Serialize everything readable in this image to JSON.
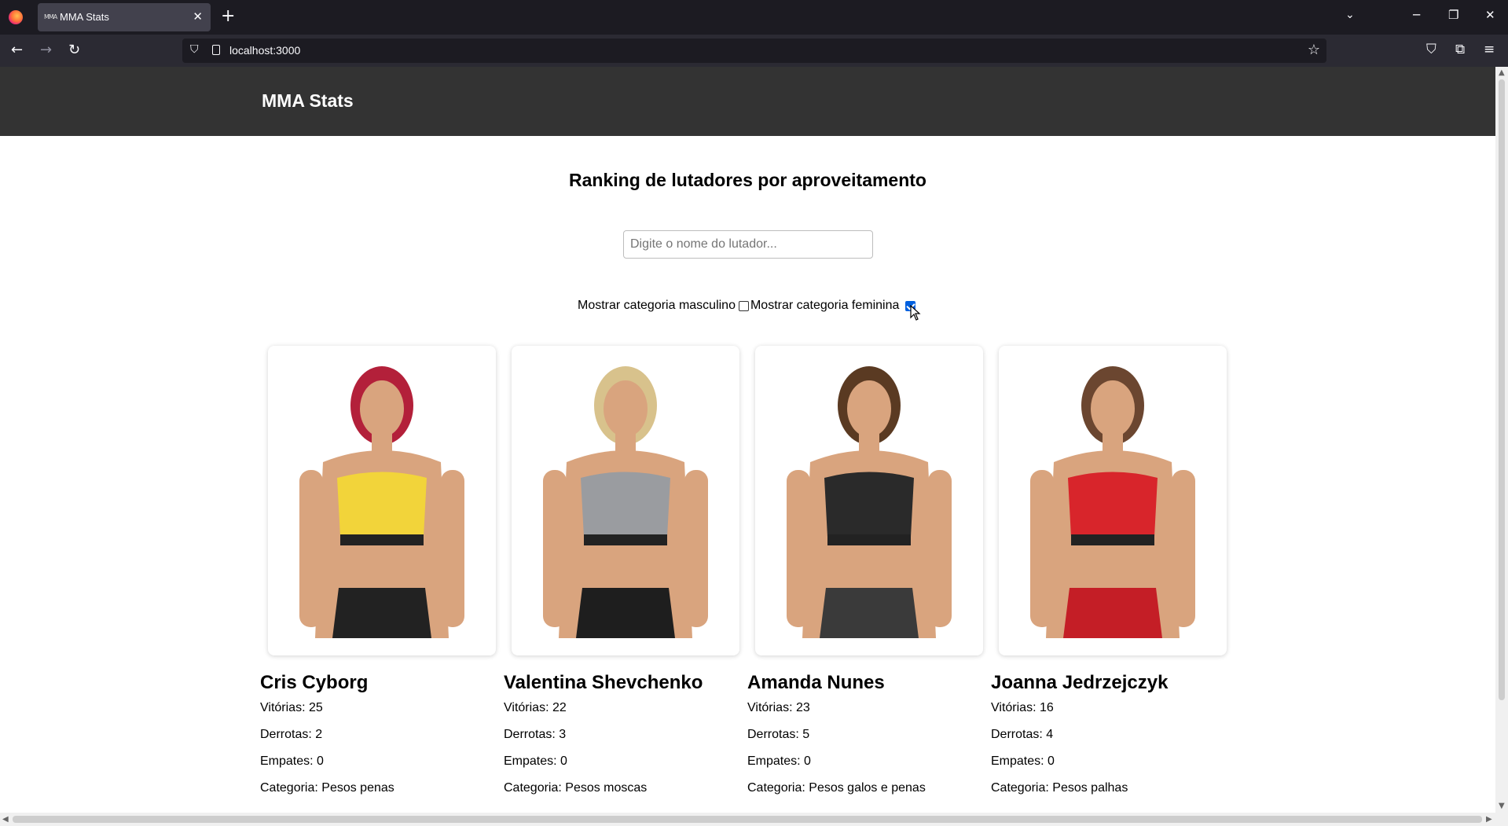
{
  "browser": {
    "tab_title": "MMA Stats",
    "tab_favicon": "MMA",
    "url": "localhost:3000"
  },
  "site": {
    "title": "MMA Stats",
    "heading": "Ranking de lutadores por aproveitamento",
    "search_placeholder": "Digite o nome do lutador...",
    "filter_male_label": "Mostrar categoria masculino",
    "filter_male_checked": false,
    "filter_female_label": "Mostrar categoria feminina",
    "filter_female_checked": true
  },
  "fighters": [
    {
      "name": "Cris Cyborg",
      "wins": "Vitórias: 25",
      "losses": "Derrotas: 2",
      "draws": "Empates: 0",
      "category": "Categoria: Pesos penas",
      "top_color": "#f2d43a",
      "bottom_color": "#222222",
      "hair_color": "#b3203a"
    },
    {
      "name": "Valentina Shevchenko",
      "wins": "Vitórias: 22",
      "losses": "Derrotas: 3",
      "draws": "Empates: 0",
      "category": "Categoria: Pesos moscas",
      "top_color": "#9a9ca0",
      "bottom_color": "#1e1e1e",
      "hair_color": "#d8c28c"
    },
    {
      "name": "Amanda Nunes",
      "wins": "Vitórias: 23",
      "losses": "Derrotas: 5",
      "draws": "Empates: 0",
      "category": "Categoria: Pesos galos e penas",
      "top_color": "#2a2a2a",
      "bottom_color": "#3a3a3a",
      "hair_color": "#5a3a22"
    },
    {
      "name": "Joanna Jedrzejczyk",
      "wins": "Vitórias: 16",
      "losses": "Derrotas: 4",
      "draws": "Empates: 0",
      "category": "Categoria: Pesos palhas",
      "top_color": "#d8252b",
      "bottom_color": "#c41e26",
      "hair_color": "#6b4630"
    }
  ]
}
